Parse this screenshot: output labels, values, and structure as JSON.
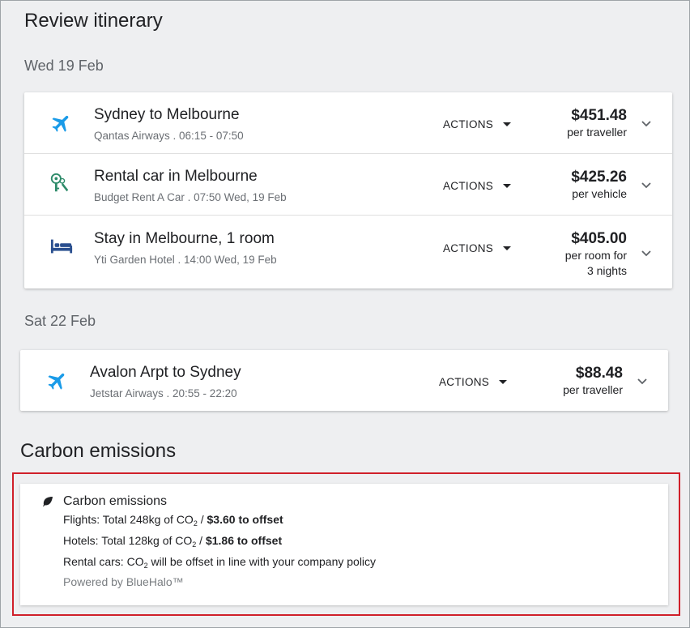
{
  "page": {
    "title": "Review itinerary"
  },
  "dates": {
    "first": "Wed 19 Feb",
    "second": "Sat 22 Feb"
  },
  "actions_label": "ACTIONS",
  "trip1": [
    {
      "icon": "airplane-icon",
      "title": "Sydney to Melbourne",
      "sub": "Qantas Airways . 06:15 - 07:50",
      "price": "$451.48",
      "note": "per traveller"
    },
    {
      "icon": "car-keys-icon",
      "title": "Rental car in Melbourne",
      "sub": "Budget Rent A Car . 07:50 Wed, 19 Feb",
      "price": "$425.26",
      "note": "per vehicle"
    },
    {
      "icon": "bed-icon",
      "title": "Stay in Melbourne, 1 room",
      "sub": "Yti Garden Hotel . 14:00 Wed, 19 Feb",
      "price": "$405.00",
      "note_line1": "per room for",
      "note_line2": "3 nights"
    }
  ],
  "trip2": [
    {
      "icon": "airplane-icon",
      "title": "Avalon Arpt to Sydney",
      "sub": "Jetstar Airways . 20:55 - 22:20",
      "price": "$88.48",
      "note": "per traveller"
    }
  ],
  "carbon": {
    "section_title": "Carbon emissions",
    "card_title": "Carbon emissions",
    "flights_prefix": "Flights: Total 248kg of CO",
    "flights_sub": "2",
    "flights_sep": " / ",
    "flights_offset": "$3.60 to offset",
    "hotels_prefix": "Hotels: Total 128kg of CO",
    "hotels_sub": "2",
    "hotels_sep": " / ",
    "hotels_offset": "$1.86 to offset",
    "rental_prefix": "Rental cars: CO",
    "rental_sub": "2",
    "rental_suffix": " will be offset in line with your company policy",
    "powered": "Powered by BlueHalo™"
  },
  "colors": {
    "plane": "#1a9be8",
    "keys": "#2e8b6a",
    "bed": "#2a4f8f",
    "highlight": "#d0202a"
  }
}
